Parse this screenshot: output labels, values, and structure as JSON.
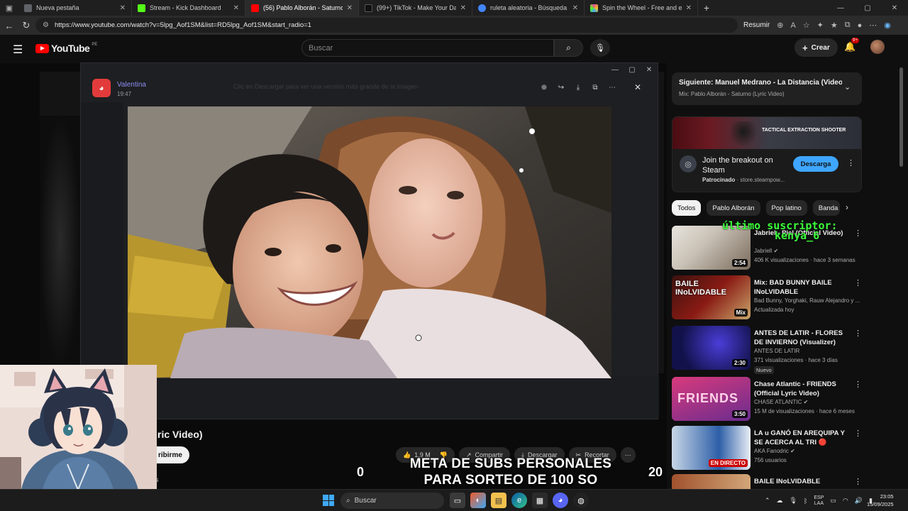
{
  "browser": {
    "tabs": [
      {
        "title": "Nueva pestaña",
        "color": "#5f6368"
      },
      {
        "title": "Stream - Kick Dashboard",
        "color": "#53fc18"
      },
      {
        "title": "(56) Pablo Alborán - Saturno (Lyric",
        "color": "#ff0000"
      },
      {
        "title": "(99+) TikTok - Make Your Day",
        "color": "#111111"
      },
      {
        "title": "ruleta aleatoria - Búsqueda",
        "color": "#4285f4"
      },
      {
        "title": "Spin the Wheel - Free and easy t",
        "color": "#e94f8f"
      }
    ],
    "url": "https://www.youtube.com/watch?v=5lpg_Aof1SM&list=RD5lpg_Aof1SM&start_radio=1",
    "resumir": "Resumir"
  },
  "youtube": {
    "logo": "YouTube",
    "country": "PE",
    "search_placeholder": "Buscar",
    "crear": "Crear",
    "notif_badge": "9+",
    "video_title_fragment": "ric Video)",
    "subscribe_fragment": "ribirme",
    "desc_fragment": "s",
    "actions": {
      "likes": "1,9 M",
      "share": "Compartir",
      "download": "Descargar",
      "clip": "Recortar"
    },
    "next": {
      "title": "Siguiente: Manuel Medrano - La Distancia (Video O...",
      "mix": "Mix: Pablo Alborán - Saturno (Lyric Video)"
    },
    "ad": {
      "banner_text": "TACTICAL EXTRACTION SHOOTER",
      "title": "Join the breakout on Steam",
      "sponsored": "Patrocinado",
      "domain": "store.steampow...",
      "button": "Descarga"
    },
    "chips": [
      "Todos",
      "Pablo Alborán",
      "Pop latino",
      "Banda s"
    ],
    "recs": [
      {
        "title": "Jabriel - Piel (Official Video)",
        "channel": "Jabriell",
        "meta": "406 K visualizaciones · hace 3 semanas",
        "duration": "2:54",
        "c1": "#7a6b5c",
        "c2": "#e8e4de"
      },
      {
        "title": "Mix: BAD BUNNY  BAILE INoLVIDABLE",
        "channel": "Bad Bunny, Yorghaki, Rauw Alejandro y ...",
        "meta": "Actualizada hoy",
        "duration": "Mix",
        "thumb_text": "BAILE INoLVIDABLE",
        "c1": "#8a1b14",
        "c2": "#c9a66b"
      },
      {
        "title": "ANTES DE LATIR - FLORES DE INVIERNO (Visualizer)",
        "channel": "ANTES DE LATIR",
        "meta": "371 visualizaciones · hace 3 días",
        "duration": "2:30",
        "badge": "Nuevo",
        "c1": "#12124a",
        "c2": "#3b2ca8"
      },
      {
        "title": "Chase Atlantic - FRIENDS (Official Lyric Video)",
        "channel": "CHASE ATLANTIC",
        "meta": "15 M de visualizaciones · hace 6 meses",
        "duration": "3:50",
        "thumb_text": "FRIENDS",
        "c1": "#d93a7c",
        "c2": "#6a2c8f"
      },
      {
        "title": "LA u GANÓ EN AREQUIPA Y SE ACERCA AL TRI 🔴 ALIANZA ...",
        "channel": "AKA Fanodric",
        "meta": "756 usuarios",
        "duration": "EN DIRECTO",
        "live": true,
        "c1": "#2d5fa8",
        "c2": "#c7d6e6"
      },
      {
        "title": "BAILE INoLVIDABLE",
        "channel": "",
        "meta": "",
        "duration": "",
        "c1": "#a0522d",
        "c2": "#d2a679"
      }
    ]
  },
  "discord": {
    "user": "Valentina",
    "time": "19:47",
    "faded_text": "Clic en Descargar para ver una versión más grande de la imagen"
  },
  "stream_overlay": {
    "green_text_1": "último suscriptor:",
    "green_text_2": "kenya_6",
    "goal_line1": "META DE SUBS PERSONALES",
    "goal_line2": "PARA SORTEO DE 100 SO",
    "goal_current": "0",
    "goal_target": "20"
  },
  "taskbar": {
    "search": "Buscar",
    "lang1": "ESP",
    "lang2": "LAA",
    "time": "23:05",
    "date": "15/09/2025"
  }
}
